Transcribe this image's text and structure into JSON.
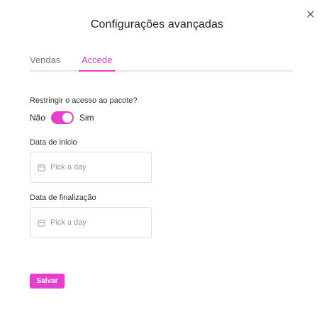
{
  "dialog": {
    "title": "Configurações avançadas"
  },
  "tabs": [
    {
      "label": "Vendas",
      "active": false
    },
    {
      "label": "Accede",
      "active": true
    }
  ],
  "access": {
    "question": "Restringir o acesso ao pacote?",
    "off_label": "Não",
    "on_label": "Sim",
    "enabled": true
  },
  "start_date": {
    "label": "Data de inicio",
    "placeholder": "Pick a day"
  },
  "end_date": {
    "label": "Data de finalização",
    "placeholder": "Pick a day"
  },
  "actions": {
    "save_label": "Salvar"
  },
  "icons": {
    "close": "close-icon",
    "calendar": "calendar-icon"
  },
  "colors": {
    "accent": "#e53fd0",
    "border": "#dcdcdc",
    "muted": "#9a9a9a"
  }
}
